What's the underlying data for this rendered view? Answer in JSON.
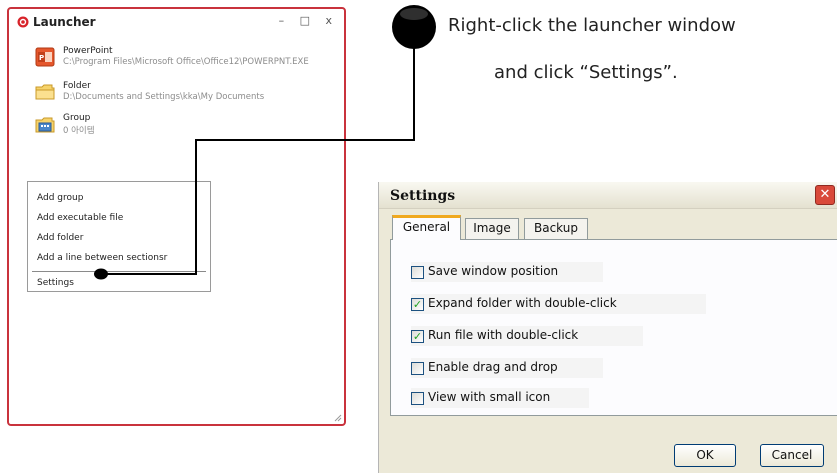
{
  "launcher": {
    "title": "Launcher",
    "window_controls": "– □ x",
    "items": [
      {
        "name": "PowerPoint",
        "path": "C:\\Program Files\\Microsoft Office\\Office12\\POWERPNT.EXE",
        "icon": "powerpoint-icon"
      },
      {
        "name": "Folder",
        "path": "D:\\Documents and Settings\\kka\\My Documents",
        "icon": "folder-icon"
      },
      {
        "name": "Group",
        "path": "0 아이템",
        "icon": "group-icon"
      }
    ],
    "context_menu": {
      "items": [
        "Add group",
        "Add executable file",
        "Add folder",
        "Add a line between sectionsr",
        "Settings"
      ]
    }
  },
  "callout": {
    "line1": "Right-click the launcher window",
    "line2": "and click “Settings”."
  },
  "settings": {
    "title": "Settings",
    "tabs": [
      {
        "label": "General",
        "active": true
      },
      {
        "label": "Image",
        "active": false
      },
      {
        "label": "Backup",
        "active": false
      }
    ],
    "options": [
      {
        "label": "Save window position",
        "checked": false
      },
      {
        "label": "Expand folder with double-click",
        "checked": true
      },
      {
        "label": "Run file with double-click",
        "checked": true
      },
      {
        "label": "Enable drag and drop",
        "checked": false
      },
      {
        "label": "View with small icon",
        "checked": false
      }
    ],
    "ok_label": "OK",
    "cancel_label": "Cancel"
  },
  "colors": {
    "launcher_border": "#c9323c",
    "connector": "#000000",
    "tab_highlight": "#f0a91e",
    "close_button": "#d9493a",
    "check_mark": "#21a121"
  }
}
